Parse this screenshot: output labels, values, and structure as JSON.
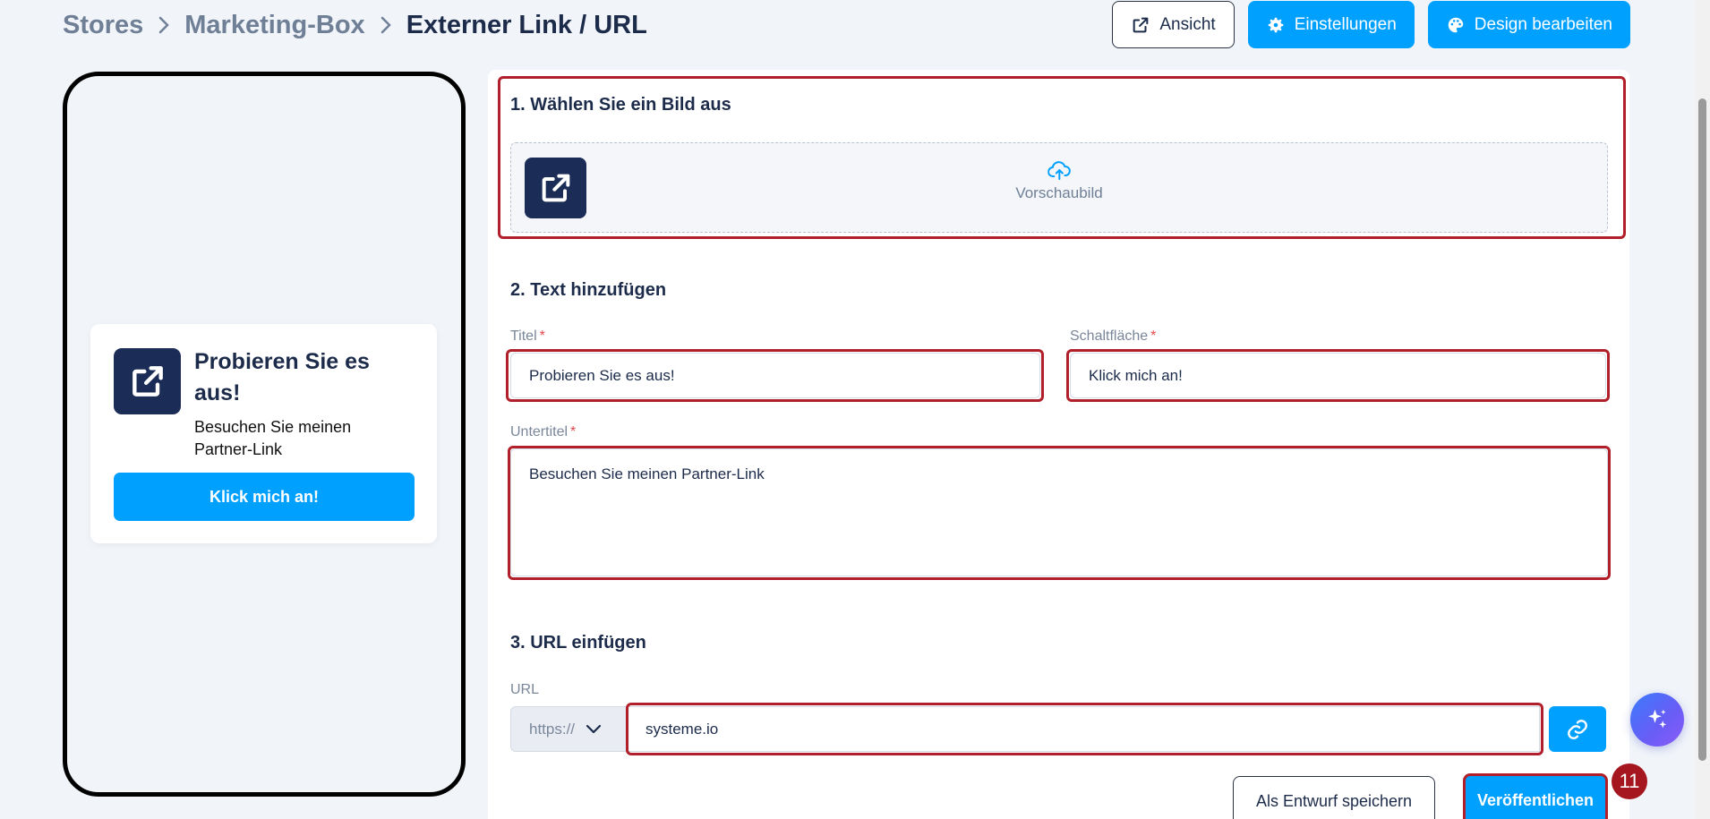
{
  "breadcrumb": {
    "items": [
      "Stores",
      "Marketing-Box"
    ],
    "current": "Externer Link / URL"
  },
  "toolbar": {
    "view_label": "Ansicht",
    "settings_label": "Einstellungen",
    "design_label": "Design bearbeiten"
  },
  "preview": {
    "title": "Probieren Sie es aus!",
    "subtitle": "Besuchen Sie meinen Partner-Link",
    "button": "Klick mich an!"
  },
  "form": {
    "section1_title": "1. Wählen Sie ein Bild aus",
    "upload_label": "Vorschaubild",
    "section2_title": "2. Text hinzufügen",
    "title_label": "Titel",
    "title_value": "Probieren Sie es aus!",
    "button_label": "Schaltfläche",
    "button_value": "Klick mich an!",
    "subtitle_label": "Untertitel",
    "subtitle_value": "Besuchen Sie meinen Partner-Link",
    "required_mark": "*",
    "section3_title": "3. URL einfügen",
    "url_label": "URL",
    "url_protocol": "https://",
    "url_value": "systeme.io"
  },
  "actions": {
    "draft_label": "Als Entwurf speichern",
    "publish_label": "Veröffentlichen"
  },
  "step_badge": "11",
  "colors": {
    "primary": "#00a0ff",
    "navy": "#1b2c57",
    "highlight": "#b1202a",
    "badge": "#a5161e"
  },
  "icons": {
    "external_link": "external-link-icon",
    "settings": "gear-icon",
    "design": "palette-icon",
    "upload": "cloud-upload-icon",
    "chevron": "chevron-down-icon",
    "link": "link-icon",
    "ai": "sparkle-icon"
  }
}
